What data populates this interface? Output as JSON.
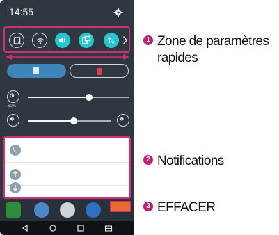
{
  "status_bar": {
    "time": "14:55"
  },
  "quick_settings": {
    "toggles": [
      {
        "name": "screen-capture",
        "state": "off"
      },
      {
        "name": "wifi",
        "state": "off"
      },
      {
        "name": "sound",
        "state": "on"
      },
      {
        "name": "rotation",
        "state": "on"
      },
      {
        "name": "data",
        "state": "on"
      }
    ]
  },
  "sim_cards": [
    {
      "label": "SIM 1",
      "color": "#3d86b8"
    },
    {
      "label": "SIM 2",
      "color": "#e53a4a"
    }
  ],
  "brightness": {
    "level": 0.6,
    "percent_label": "60%"
  },
  "volume": {
    "level": 0.55
  },
  "callouts": [
    {
      "number": "1",
      "text": "Zone de paramètres rapides"
    },
    {
      "number": "2",
      "text": "Notifications"
    },
    {
      "number": "3",
      "text": "EFFACER"
    }
  ],
  "colors": {
    "accent": "#26c6d2",
    "highlight_border": "#d12f77",
    "badge": "#c21f6f",
    "clear_button": "#ea6d2f"
  }
}
